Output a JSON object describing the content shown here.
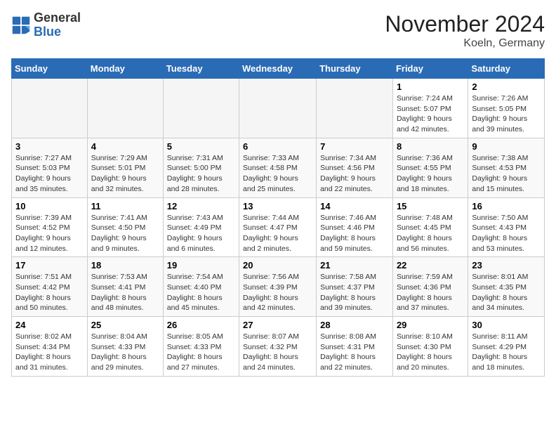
{
  "header": {
    "logo_line1": "General",
    "logo_line2": "Blue",
    "month": "November 2024",
    "location": "Koeln, Germany"
  },
  "weekdays": [
    "Sunday",
    "Monday",
    "Tuesday",
    "Wednesday",
    "Thursday",
    "Friday",
    "Saturday"
  ],
  "weeks": [
    [
      {
        "day": "",
        "detail": ""
      },
      {
        "day": "",
        "detail": ""
      },
      {
        "day": "",
        "detail": ""
      },
      {
        "day": "",
        "detail": ""
      },
      {
        "day": "",
        "detail": ""
      },
      {
        "day": "1",
        "detail": "Sunrise: 7:24 AM\nSunset: 5:07 PM\nDaylight: 9 hours and 42 minutes."
      },
      {
        "day": "2",
        "detail": "Sunrise: 7:26 AM\nSunset: 5:05 PM\nDaylight: 9 hours and 39 minutes."
      }
    ],
    [
      {
        "day": "3",
        "detail": "Sunrise: 7:27 AM\nSunset: 5:03 PM\nDaylight: 9 hours and 35 minutes."
      },
      {
        "day": "4",
        "detail": "Sunrise: 7:29 AM\nSunset: 5:01 PM\nDaylight: 9 hours and 32 minutes."
      },
      {
        "day": "5",
        "detail": "Sunrise: 7:31 AM\nSunset: 5:00 PM\nDaylight: 9 hours and 28 minutes."
      },
      {
        "day": "6",
        "detail": "Sunrise: 7:33 AM\nSunset: 4:58 PM\nDaylight: 9 hours and 25 minutes."
      },
      {
        "day": "7",
        "detail": "Sunrise: 7:34 AM\nSunset: 4:56 PM\nDaylight: 9 hours and 22 minutes."
      },
      {
        "day": "8",
        "detail": "Sunrise: 7:36 AM\nSunset: 4:55 PM\nDaylight: 9 hours and 18 minutes."
      },
      {
        "day": "9",
        "detail": "Sunrise: 7:38 AM\nSunset: 4:53 PM\nDaylight: 9 hours and 15 minutes."
      }
    ],
    [
      {
        "day": "10",
        "detail": "Sunrise: 7:39 AM\nSunset: 4:52 PM\nDaylight: 9 hours and 12 minutes."
      },
      {
        "day": "11",
        "detail": "Sunrise: 7:41 AM\nSunset: 4:50 PM\nDaylight: 9 hours and 9 minutes."
      },
      {
        "day": "12",
        "detail": "Sunrise: 7:43 AM\nSunset: 4:49 PM\nDaylight: 9 hours and 6 minutes."
      },
      {
        "day": "13",
        "detail": "Sunrise: 7:44 AM\nSunset: 4:47 PM\nDaylight: 9 hours and 2 minutes."
      },
      {
        "day": "14",
        "detail": "Sunrise: 7:46 AM\nSunset: 4:46 PM\nDaylight: 8 hours and 59 minutes."
      },
      {
        "day": "15",
        "detail": "Sunrise: 7:48 AM\nSunset: 4:45 PM\nDaylight: 8 hours and 56 minutes."
      },
      {
        "day": "16",
        "detail": "Sunrise: 7:50 AM\nSunset: 4:43 PM\nDaylight: 8 hours and 53 minutes."
      }
    ],
    [
      {
        "day": "17",
        "detail": "Sunrise: 7:51 AM\nSunset: 4:42 PM\nDaylight: 8 hours and 50 minutes."
      },
      {
        "day": "18",
        "detail": "Sunrise: 7:53 AM\nSunset: 4:41 PM\nDaylight: 8 hours and 48 minutes."
      },
      {
        "day": "19",
        "detail": "Sunrise: 7:54 AM\nSunset: 4:40 PM\nDaylight: 8 hours and 45 minutes."
      },
      {
        "day": "20",
        "detail": "Sunrise: 7:56 AM\nSunset: 4:39 PM\nDaylight: 8 hours and 42 minutes."
      },
      {
        "day": "21",
        "detail": "Sunrise: 7:58 AM\nSunset: 4:37 PM\nDaylight: 8 hours and 39 minutes."
      },
      {
        "day": "22",
        "detail": "Sunrise: 7:59 AM\nSunset: 4:36 PM\nDaylight: 8 hours and 37 minutes."
      },
      {
        "day": "23",
        "detail": "Sunrise: 8:01 AM\nSunset: 4:35 PM\nDaylight: 8 hours and 34 minutes."
      }
    ],
    [
      {
        "day": "24",
        "detail": "Sunrise: 8:02 AM\nSunset: 4:34 PM\nDaylight: 8 hours and 31 minutes."
      },
      {
        "day": "25",
        "detail": "Sunrise: 8:04 AM\nSunset: 4:33 PM\nDaylight: 8 hours and 29 minutes."
      },
      {
        "day": "26",
        "detail": "Sunrise: 8:05 AM\nSunset: 4:33 PM\nDaylight: 8 hours and 27 minutes."
      },
      {
        "day": "27",
        "detail": "Sunrise: 8:07 AM\nSunset: 4:32 PM\nDaylight: 8 hours and 24 minutes."
      },
      {
        "day": "28",
        "detail": "Sunrise: 8:08 AM\nSunset: 4:31 PM\nDaylight: 8 hours and 22 minutes."
      },
      {
        "day": "29",
        "detail": "Sunrise: 8:10 AM\nSunset: 4:30 PM\nDaylight: 8 hours and 20 minutes."
      },
      {
        "day": "30",
        "detail": "Sunrise: 8:11 AM\nSunset: 4:29 PM\nDaylight: 8 hours and 18 minutes."
      }
    ]
  ]
}
